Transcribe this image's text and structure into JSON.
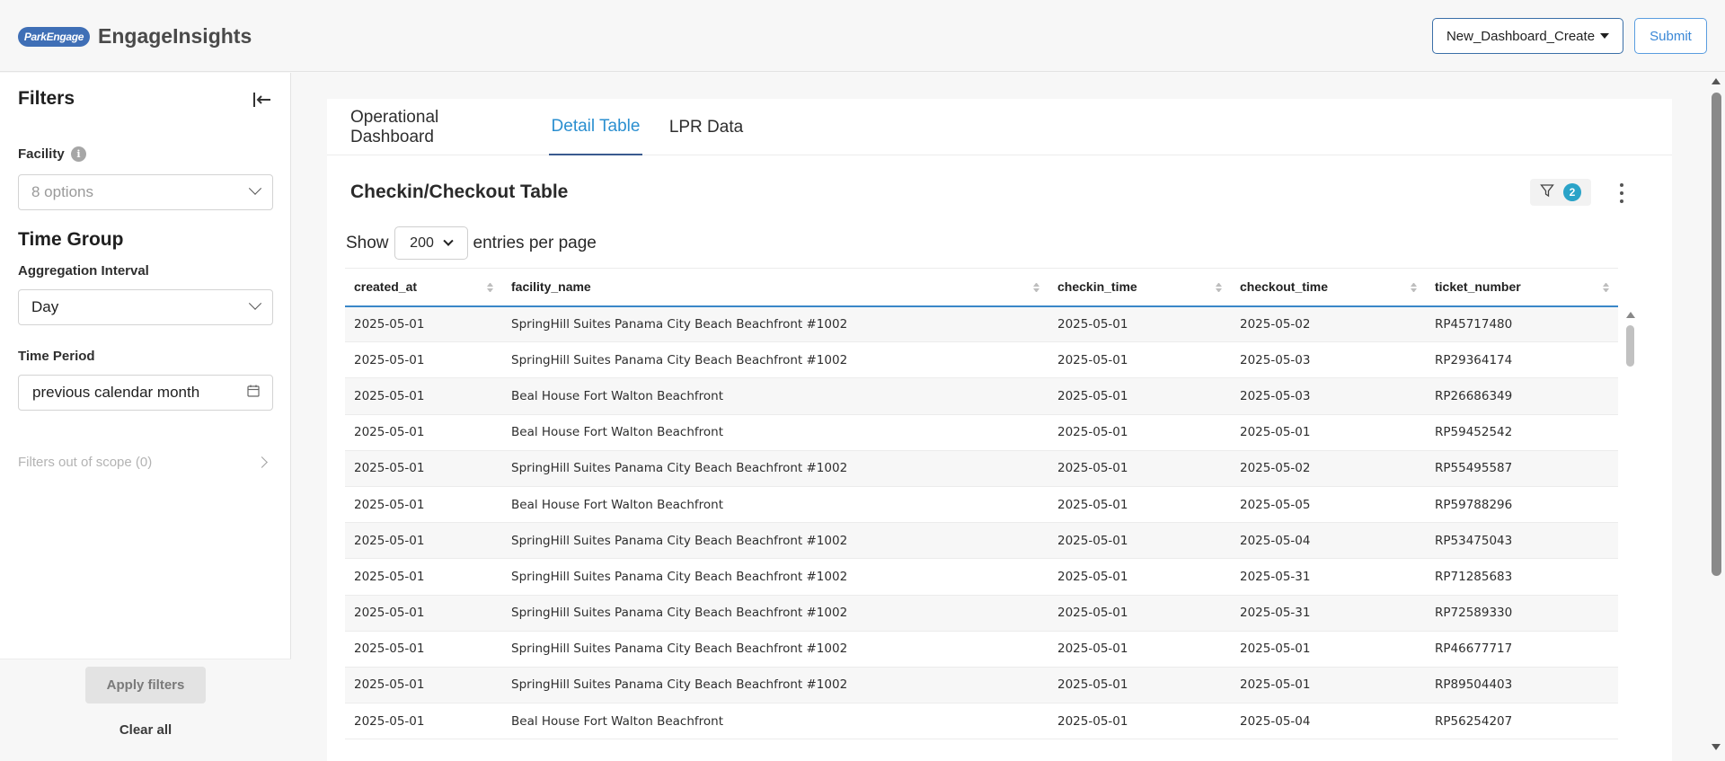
{
  "header": {
    "logo_text": "ParkEngage",
    "brand": "EngageInsights",
    "dashboard_select": "New_Dashboard_Create",
    "submit_label": "Submit"
  },
  "sidebar": {
    "title": "Filters",
    "facility_label": "Facility",
    "facility_placeholder": "8 options",
    "time_group_title": "Time Group",
    "aggregation_label": "Aggregation Interval",
    "aggregation_value": "Day",
    "time_period_label": "Time Period",
    "time_period_value": "previous calendar month",
    "out_of_scope": "Filters out of scope (0)",
    "apply_label": "Apply filters",
    "clear_label": "Clear all"
  },
  "tabs": [
    {
      "label": "Operational Dashboard",
      "active": false
    },
    {
      "label": "Detail Table",
      "active": true
    },
    {
      "label": "LPR Data",
      "active": false
    }
  ],
  "table_panel": {
    "title": "Checkin/Checkout Table",
    "filter_count": "2",
    "show_label": "Show",
    "page_size": "200",
    "entries_label": "entries per page"
  },
  "table": {
    "columns": [
      "created_at",
      "facility_name",
      "checkin_time",
      "checkout_time",
      "ticket_number"
    ],
    "rows": [
      [
        "2025-05-01",
        "SpringHill Suites Panama City Beach Beachfront #1002",
        "2025-05-01",
        "2025-05-02",
        "RP45717480"
      ],
      [
        "2025-05-01",
        "SpringHill Suites Panama City Beach Beachfront #1002",
        "2025-05-01",
        "2025-05-03",
        "RP29364174"
      ],
      [
        "2025-05-01",
        "Beal House Fort Walton Beachfront",
        "2025-05-01",
        "2025-05-03",
        "RP26686349"
      ],
      [
        "2025-05-01",
        "Beal House Fort Walton Beachfront",
        "2025-05-01",
        "2025-05-01",
        "RP59452542"
      ],
      [
        "2025-05-01",
        "SpringHill Suites Panama City Beach Beachfront #1002",
        "2025-05-01",
        "2025-05-02",
        "RP55495587"
      ],
      [
        "2025-05-01",
        "Beal House Fort Walton Beachfront",
        "2025-05-01",
        "2025-05-05",
        "RP59788296"
      ],
      [
        "2025-05-01",
        "SpringHill Suites Panama City Beach Beachfront #1002",
        "2025-05-01",
        "2025-05-04",
        "RP53475043"
      ],
      [
        "2025-05-01",
        "SpringHill Suites Panama City Beach Beachfront #1002",
        "2025-05-01",
        "2025-05-31",
        "RP71285683"
      ],
      [
        "2025-05-01",
        "SpringHill Suites Panama City Beach Beachfront #1002",
        "2025-05-01",
        "2025-05-31",
        "RP72589330"
      ],
      [
        "2025-05-01",
        "SpringHill Suites Panama City Beach Beachfront #1002",
        "2025-05-01",
        "2025-05-01",
        "RP46677717"
      ],
      [
        "2025-05-01",
        "SpringHill Suites Panama City Beach Beachfront #1002",
        "2025-05-01",
        "2025-05-01",
        "RP89504403"
      ],
      [
        "2025-05-01",
        "Beal House Fort Walton Beachfront",
        "2025-05-01",
        "2025-05-04",
        "RP56254207"
      ]
    ]
  },
  "colors": {
    "accent": "#2b8fd0",
    "badge": "#2aa3c8",
    "header_border": "#3a87c8"
  },
  "icons": [
    "info-icon",
    "collapse-left-icon",
    "calendar-icon",
    "filter-icon",
    "kebab-menu-icon",
    "chevron-down-icon",
    "chevron-right-icon",
    "sort-icon"
  ]
}
